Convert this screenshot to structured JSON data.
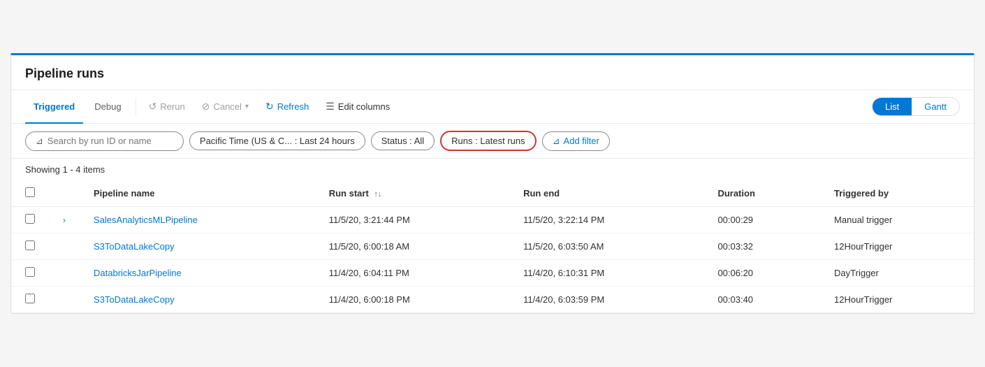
{
  "page": {
    "title": "Pipeline runs",
    "showing_text": "Showing 1 - 4 items"
  },
  "toolbar": {
    "tabs": [
      {
        "id": "triggered",
        "label": "Triggered",
        "active": true
      },
      {
        "id": "debug",
        "label": "Debug",
        "active": false
      }
    ],
    "buttons": [
      {
        "id": "rerun",
        "label": "Rerun",
        "icon": "↺",
        "disabled": true
      },
      {
        "id": "cancel",
        "label": "Cancel",
        "icon": "⊘",
        "disabled": true,
        "has_dropdown": true
      },
      {
        "id": "refresh",
        "label": "Refresh",
        "icon": "↻",
        "disabled": false
      }
    ],
    "edit_columns_label": "Edit columns",
    "toggle": {
      "options": [
        {
          "id": "list",
          "label": "List",
          "active": true
        },
        {
          "id": "gantt",
          "label": "Gantt",
          "active": false
        }
      ]
    }
  },
  "filters": {
    "search_placeholder": "Search by run ID or name",
    "time_filter": "Pacific Time (US & C... : Last 24 hours",
    "status_filter": "Status : All",
    "runs_filter": "Runs : Latest runs",
    "add_filter_label": "Add filter"
  },
  "table": {
    "columns": [
      {
        "id": "pipeline_name",
        "label": "Pipeline name"
      },
      {
        "id": "run_start",
        "label": "Run start",
        "sortable": true
      },
      {
        "id": "run_end",
        "label": "Run end"
      },
      {
        "id": "duration",
        "label": "Duration"
      },
      {
        "id": "triggered_by",
        "label": "Triggered by"
      }
    ],
    "rows": [
      {
        "id": 1,
        "has_expand": true,
        "pipeline_name": "SalesAnalyticsMLPipeline",
        "run_start": "11/5/20, 3:21:44 PM",
        "run_end": "11/5/20, 3:22:14 PM",
        "duration": "00:00:29",
        "triggered_by": "Manual trigger"
      },
      {
        "id": 2,
        "has_expand": false,
        "pipeline_name": "S3ToDataLakeCopy",
        "run_start": "11/5/20, 6:00:18 AM",
        "run_end": "11/5/20, 6:03:50 AM",
        "duration": "00:03:32",
        "triggered_by": "12HourTrigger"
      },
      {
        "id": 3,
        "has_expand": false,
        "pipeline_name": "DatabricksJarPipeline",
        "run_start": "11/4/20, 6:04:11 PM",
        "run_end": "11/4/20, 6:10:31 PM",
        "duration": "00:06:20",
        "triggered_by": "DayTrigger"
      },
      {
        "id": 4,
        "has_expand": false,
        "pipeline_name": "S3ToDataLakeCopy",
        "run_start": "11/4/20, 6:00:18 PM",
        "run_end": "11/4/20, 6:03:59 PM",
        "duration": "00:03:40",
        "triggered_by": "12HourTrigger"
      }
    ]
  },
  "icons": {
    "filter": "⊿",
    "sort": "↑↓",
    "rerun": "↺",
    "cancel": "⊘",
    "refresh": "↻",
    "edit_columns": "☰",
    "add_filter": "⊿",
    "chevron_right": "›"
  }
}
